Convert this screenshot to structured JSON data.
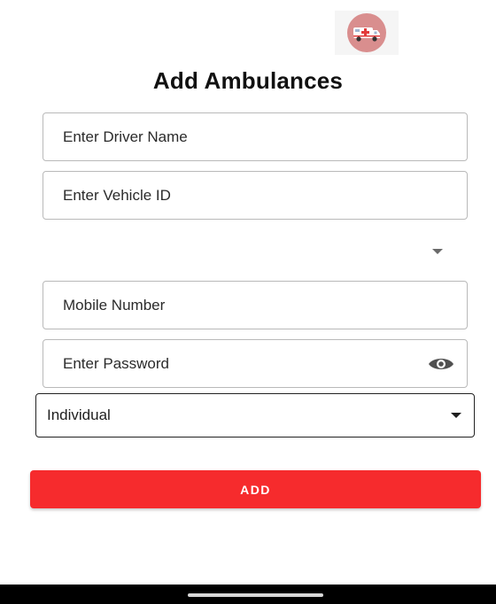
{
  "header": {
    "logo_icon": "ambulance-icon",
    "title": "Add Ambulances"
  },
  "form": {
    "driver_name": {
      "placeholder": "Enter Driver Name",
      "value": ""
    },
    "vehicle_id": {
      "placeholder": "Enter Vehicle ID",
      "value": ""
    },
    "type_dropdown": {
      "value": "",
      "icon": "dropdown-arrow-icon"
    },
    "mobile_number": {
      "placeholder": "Mobile Number",
      "value": ""
    },
    "password": {
      "placeholder": "Enter Password",
      "value": "",
      "toggle_icon": "eye-icon"
    },
    "owner_type": {
      "selected": "Individual",
      "icon": "dropdown-arrow-icon"
    },
    "submit_label": "ADD"
  },
  "colors": {
    "accent": "#f62b2d",
    "logo_bg": "#d98e8e",
    "nav_bar": "#000000"
  }
}
